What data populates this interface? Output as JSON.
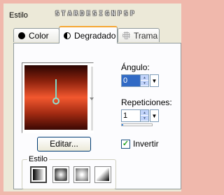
{
  "header": {
    "title": "Estilo",
    "watermark": "STARDESIGNPSP"
  },
  "tabs": [
    {
      "label": "Color",
      "icon": "solid-disc-icon"
    },
    {
      "label": "Degradado",
      "icon": "half-disc-icon",
      "active": true
    },
    {
      "label": "Trama",
      "icon": "pattern-disc-icon"
    }
  ],
  "gradient": {
    "colors": [
      "#2a0502",
      "#8d220d",
      "#f2582f",
      "#a12a12",
      "#3b0803"
    ]
  },
  "angle": {
    "label": "Ángulo:",
    "value": "0"
  },
  "repeats": {
    "label": "Repeticiones:",
    "value": "1",
    "level": 0.05
  },
  "edit_button": "Editar...",
  "invert": {
    "label": "Invertir",
    "checked": true
  },
  "style_group": {
    "label": "Estilo",
    "options": [
      "linear",
      "rectangular",
      "sunburst",
      "radial"
    ],
    "selected": "linear"
  }
}
